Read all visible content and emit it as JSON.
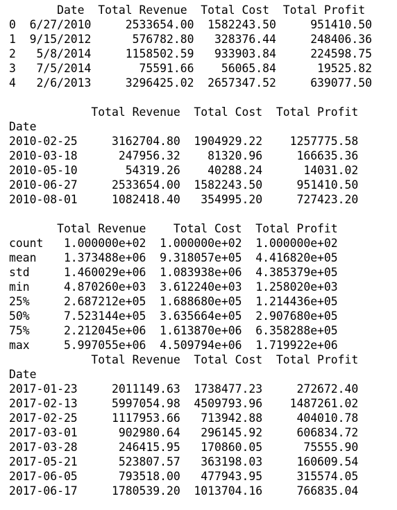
{
  "head_table": {
    "header": "       Date  Total Revenue  Total Cost  Total Profit",
    "rows": [
      "0  6/27/2010     2533654.00  1582243.50     951410.50",
      "1  9/15/2012      576782.80   328376.44     248406.36",
      "2   5/8/2014     1158502.59   933903.84     224598.75",
      "3   7/5/2014       75591.66    56065.84      19525.82",
      "4   2/6/2013     3296425.02  2657347.52     639077.50"
    ]
  },
  "indexed_table": {
    "header": "            Total Revenue  Total Cost  Total Profit",
    "index_label": "Date",
    "rows": [
      "2010-02-25     3162704.80  1904929.22    1257775.58",
      "2010-03-18      247956.32    81320.96     166635.36",
      "2010-05-10       54319.26    40288.24      14031.02",
      "2010-06-27     2533654.00  1582243.50     951410.50",
      "2010-08-01     1082418.40   354995.20     727423.20"
    ]
  },
  "describe_table": {
    "header": "       Total Revenue    Total Cost  Total Profit",
    "rows": [
      "count   1.000000e+02  1.000000e+02  1.000000e+02",
      "mean    1.373488e+06  9.318057e+05  4.416820e+05",
      "std     1.460029e+06  1.083938e+06  4.385379e+05",
      "min     4.870260e+03  3.612240e+03  1.258020e+03",
      "25%     2.687212e+05  1.688680e+05  1.214436e+05",
      "50%     7.523144e+05  3.635664e+05  2.907680e+05",
      "75%     2.212045e+06  1.613870e+06  6.358288e+05",
      "max     5.997055e+06  4.509794e+06  1.719922e+06"
    ]
  },
  "filtered_table": {
    "header": "            Total Revenue  Total Cost  Total Profit",
    "index_label": "Date",
    "rows": [
      "2017-01-23     2011149.63  1738477.23     272672.40",
      "2017-02-13     5997054.98  4509793.96    1487261.02",
      "2017-02-25     1117953.66   713942.88     404010.78",
      "2017-03-01      902980.64   296145.92     606834.72",
      "2017-03-28      246415.95   170860.05      75555.90",
      "2017-05-21      523807.57   363198.03     160609.54",
      "2017-06-05      793518.00   477943.95     315574.05",
      "2017-06-17     1780539.20  1013704.16     766835.04"
    ]
  }
}
